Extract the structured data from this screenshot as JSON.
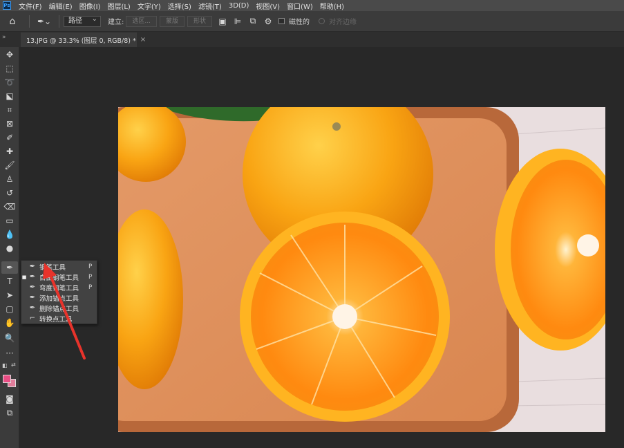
{
  "menubar": {
    "logo": "Ps",
    "items": [
      "文件(F)",
      "编辑(E)",
      "图像(I)",
      "图层(L)",
      "文字(Y)",
      "选择(S)",
      "滤镜(T)",
      "3D(D)",
      "视图(V)",
      "窗口(W)",
      "帮助(H)"
    ]
  },
  "options": {
    "mode_value": "路径",
    "make_label": "建立:",
    "selection_btn": "选区...",
    "mask_btn": "蒙版",
    "shape_btn": "形状",
    "magnetic_label": "磁性的",
    "align_edges_label": "对齐边缘"
  },
  "document": {
    "tab_title": "13.JPG @ 33.3% (图层 0, RGB/8) *",
    "close_glyph": "×"
  },
  "toolbox": {
    "collapse_glyph": "»"
  },
  "flyout": {
    "items": [
      {
        "label": "钢笔工具",
        "key": "P",
        "selected": false
      },
      {
        "label": "自由钢笔工具",
        "key": "P",
        "selected": true
      },
      {
        "label": "弯度钢笔工具",
        "key": "P",
        "selected": false
      },
      {
        "label": "添加锚点工具",
        "key": "",
        "selected": false
      },
      {
        "label": "删除锚点工具",
        "key": "",
        "selected": false
      },
      {
        "label": "转换点工具",
        "key": "",
        "selected": false
      }
    ]
  },
  "colors": {
    "foreground": "#e94d84",
    "background": "#e07d9a",
    "annotation_arrow": "#e8332b"
  }
}
